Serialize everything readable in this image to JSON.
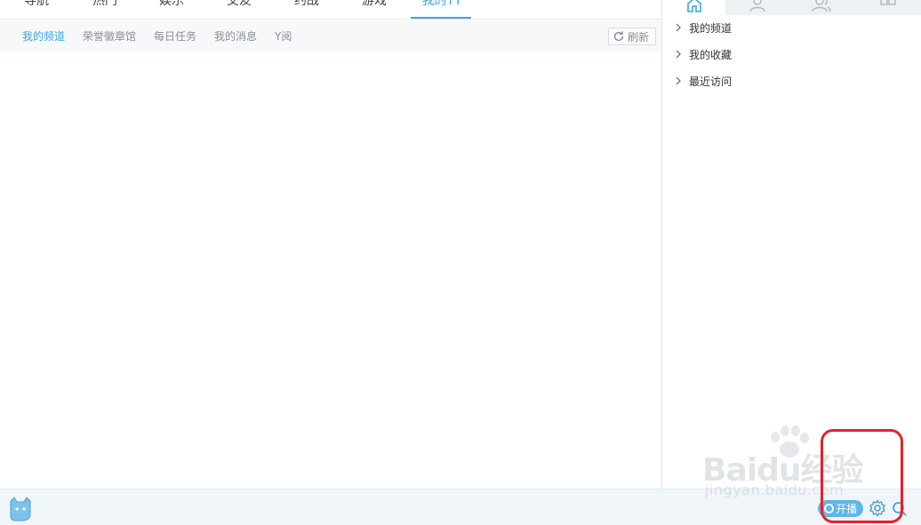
{
  "topnav": {
    "tabs": [
      {
        "label": "导航"
      },
      {
        "label": "热门"
      },
      {
        "label": "娱乐"
      },
      {
        "label": "交友"
      },
      {
        "label": "约战"
      },
      {
        "label": "游戏"
      },
      {
        "label": "我的YY",
        "active": true
      }
    ]
  },
  "subnav": {
    "items": [
      {
        "label": "我的频道",
        "active": true
      },
      {
        "label": "荣誉徽章馆"
      },
      {
        "label": "每日任务"
      },
      {
        "label": "我的消息"
      },
      {
        "label": "Y阅"
      }
    ],
    "refresh_label": "刷新"
  },
  "right_panel": {
    "tabs": [
      {
        "icon": "home-icon",
        "active": true
      },
      {
        "icon": "contact-icon"
      },
      {
        "icon": "group-icon"
      },
      {
        "icon": "apps-icon"
      }
    ],
    "tree": [
      {
        "label": "我的频道"
      },
      {
        "label": "我的收藏"
      },
      {
        "label": "最近访问"
      }
    ]
  },
  "bottombar": {
    "live_label": "开播",
    "logo_icon": "yy-cat-logo-icon",
    "settings_icon": "gear-icon",
    "search_icon": "search-icon"
  },
  "watermark": {
    "brand": "Baidu经验",
    "url": "jingyan.baidu.com"
  },
  "colors": {
    "accent": "#3aa6e6",
    "live_button": "#5eb5ea",
    "annotation": "#e8202c"
  }
}
